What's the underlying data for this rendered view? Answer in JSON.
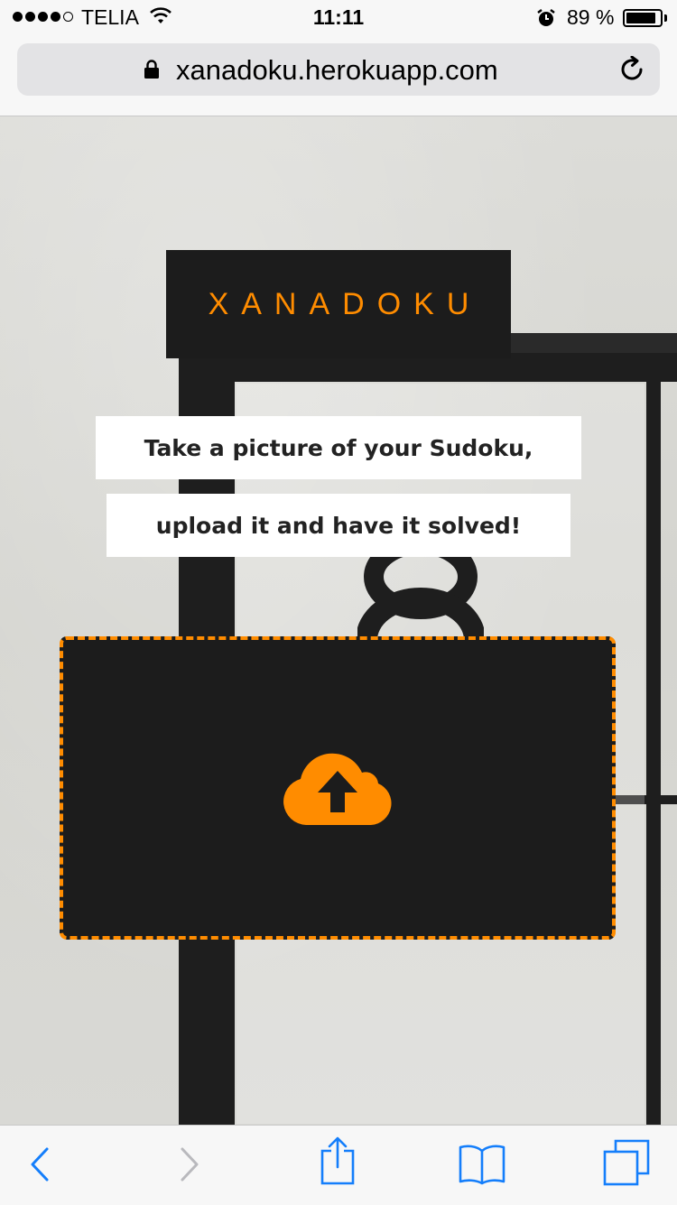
{
  "status_bar": {
    "carrier": "TELIA",
    "time": "11:11",
    "battery_percent": "89 %",
    "battery_level": 0.89,
    "signal_bars": 4
  },
  "browser": {
    "url": "xanadoku.herokuapp.com"
  },
  "page": {
    "logo": "XANADOKU",
    "tagline_line1": "Take a picture of your Sudoku,",
    "tagline_line2": "upload it and have it solved!",
    "upload_icon": "cloud-upload-icon"
  },
  "toolbar": {
    "icons": [
      "back-icon",
      "forward-icon",
      "share-icon",
      "bookmarks-icon",
      "tabs-icon"
    ]
  },
  "colors": {
    "accent": "#ff8c00",
    "dark_panel": "#1c1c1c",
    "ios_blue": "#147efb"
  }
}
